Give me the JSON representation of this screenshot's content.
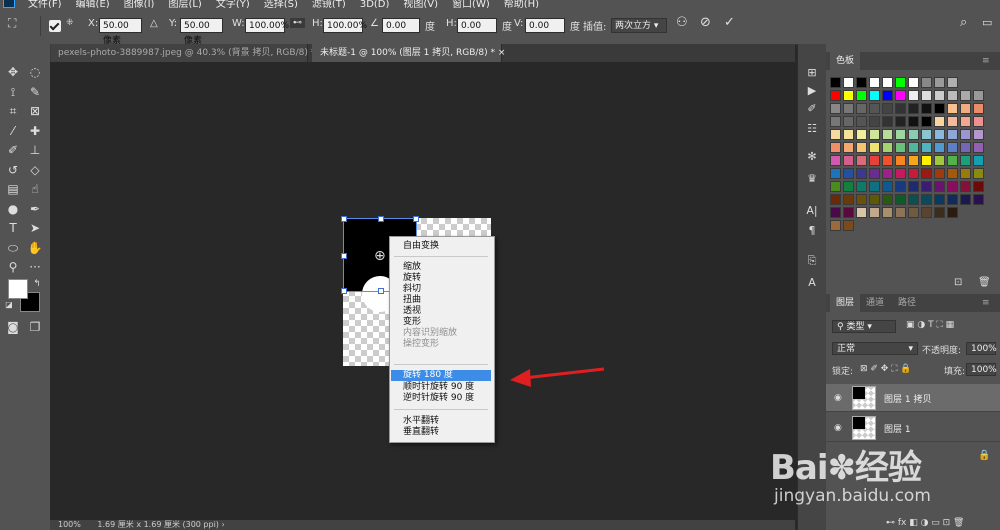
{
  "menubar": {
    "items": [
      "文件(F)",
      "编辑(E)",
      "图像(I)",
      "图层(L)",
      "文字(Y)",
      "选择(S)",
      "滤镜(T)",
      "3D(D)",
      "视图(V)",
      "窗口(W)",
      "帮助(H)"
    ]
  },
  "options": {
    "x_label": "X:",
    "x_value": "50.00 像素",
    "y_label": "Y:",
    "y_value": "50.00 像素",
    "w_label": "W:",
    "w_value": "100.00%",
    "h_label": "H:",
    "h_value": "100.00%",
    "angle_value": "0.00",
    "angle_unit": "度",
    "hskew_label": "H:",
    "hskew_value": "0.00",
    "hskew_unit": "度",
    "vskew_label": "V:",
    "vskew_value": "0.00",
    "vskew_unit": "度",
    "interp_label": "插值:",
    "interp_value": "两次立方"
  },
  "tabs": [
    {
      "label": "pexels-photo-3889987.jpeg @ 40.3% (背景 拷贝, RGB/8) *",
      "active": false
    },
    {
      "label": "未标题-1 @ 100% (图层 1 拷贝, RGB/8) *",
      "active": true
    }
  ],
  "context_menu": {
    "items": [
      {
        "label": "自由变换",
        "state": "normal"
      },
      {
        "label": "缩放",
        "state": "normal"
      },
      {
        "label": "旋转",
        "state": "normal"
      },
      {
        "label": "斜切",
        "state": "normal"
      },
      {
        "label": "扭曲",
        "state": "normal"
      },
      {
        "label": "透视",
        "state": "normal"
      },
      {
        "label": "变形",
        "state": "normal"
      },
      {
        "label": "内容识别缩放",
        "state": "disabled"
      },
      {
        "label": "操控变形",
        "state": "disabled"
      },
      {
        "label": "旋转 180 度",
        "state": "highlighted"
      },
      {
        "label": "顺时针旋转 90 度",
        "state": "normal"
      },
      {
        "label": "逆时针旋转 90 度",
        "state": "normal"
      },
      {
        "label": "水平翻转",
        "state": "normal"
      },
      {
        "label": "垂直翻转",
        "state": "normal"
      }
    ]
  },
  "status": {
    "zoom": "100%",
    "doc_info": "1.69 厘米 x 1.69 厘米 (300 ppi)"
  },
  "swatches_panel": {
    "tab_label": "色板"
  },
  "layers_panel": {
    "tabs": [
      "图层",
      "通道",
      "路径"
    ],
    "filter_label": "类型",
    "blend_mode": "正常",
    "opacity_label": "不透明度:",
    "opacity_value": "100%",
    "lock_label": "锁定:",
    "fill_label": "填充:",
    "fill_value": "100%",
    "layers": [
      {
        "name": "图层 1 拷贝",
        "selected": true
      },
      {
        "name": "图层 1",
        "selected": false
      }
    ]
  },
  "watermark": {
    "logo_text": "Bai",
    "logo_text2": "经验",
    "url": "jingyan.baidu.com"
  },
  "colors": {
    "highlight": "#3d8de8",
    "arrow": "#e02020",
    "handle_border": "#3d6fd8"
  }
}
